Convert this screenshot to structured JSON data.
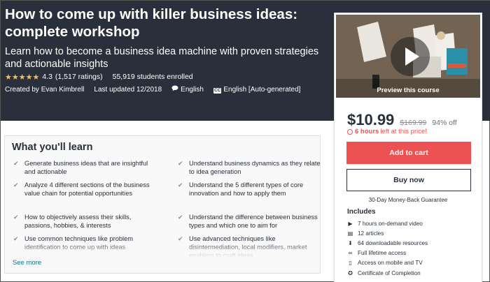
{
  "course": {
    "title": "How to come up with killer business ideas: complete workshop",
    "subtitle": "Learn how to become a business idea machine with proven strategies and actionable insights",
    "stars": "★★★★★",
    "rating": "4.3",
    "ratings_count": "(1,517 ratings)",
    "enrolled": "55,919 students enrolled",
    "created_by": "Created by Evan Kimbrell",
    "last_updated": "Last updated 12/2018",
    "language": "English",
    "captions": "English [Auto-generated]",
    "cc_icon_text": "CC"
  },
  "preview": {
    "label": "Preview this course"
  },
  "pricing": {
    "price": "$10.99",
    "original_price": "$169.99",
    "discount": "94% off",
    "timer_hours": "6 hours",
    "timer_suffix": "left at this price!",
    "add_to_cart": "Add to cart",
    "buy_now": "Buy now",
    "guarantee": "30-Day Money-Back Guarantee"
  },
  "includes": {
    "title": "Includes",
    "items": [
      {
        "icon": "video-icon",
        "glyph": "▶",
        "label": "7 hours on-demand video"
      },
      {
        "icon": "article-icon",
        "glyph": "▤",
        "label": "12 articles"
      },
      {
        "icon": "download-icon",
        "glyph": "⬇",
        "label": "64 downloadable resources"
      },
      {
        "icon": "infinity-icon",
        "glyph": "∞",
        "label": "Full lifetime access"
      },
      {
        "icon": "mobile-icon",
        "glyph": "▯",
        "label": "Access on mobile and TV"
      },
      {
        "icon": "certificate-icon",
        "glyph": "✪",
        "label": "Certificate of Completion"
      }
    ]
  },
  "learn": {
    "title": "What you'll learn",
    "items": [
      "Generate business ideas that are insightful and actionable",
      "Understand business dynamics as they relate to idea generation",
      "Analyze 4 different sections of the business value chain for potential opportunities",
      "Understand the 5 different types of core innovation and how to apply them",
      "How to objectively assess their skills, passions, hobbies, & interests",
      "Understand the difference between business types and which one to aim for",
      "Use common techniques like problem identification to come up with ideas",
      "Use advanced techniques like disintermediation, local modifiers, market enablers to craft ideas"
    ],
    "see_more": "See more"
  },
  "colors": {
    "header_bg": "#29303b",
    "accent_red": "#ec5252",
    "star": "#f4c150",
    "link": "#007791"
  }
}
